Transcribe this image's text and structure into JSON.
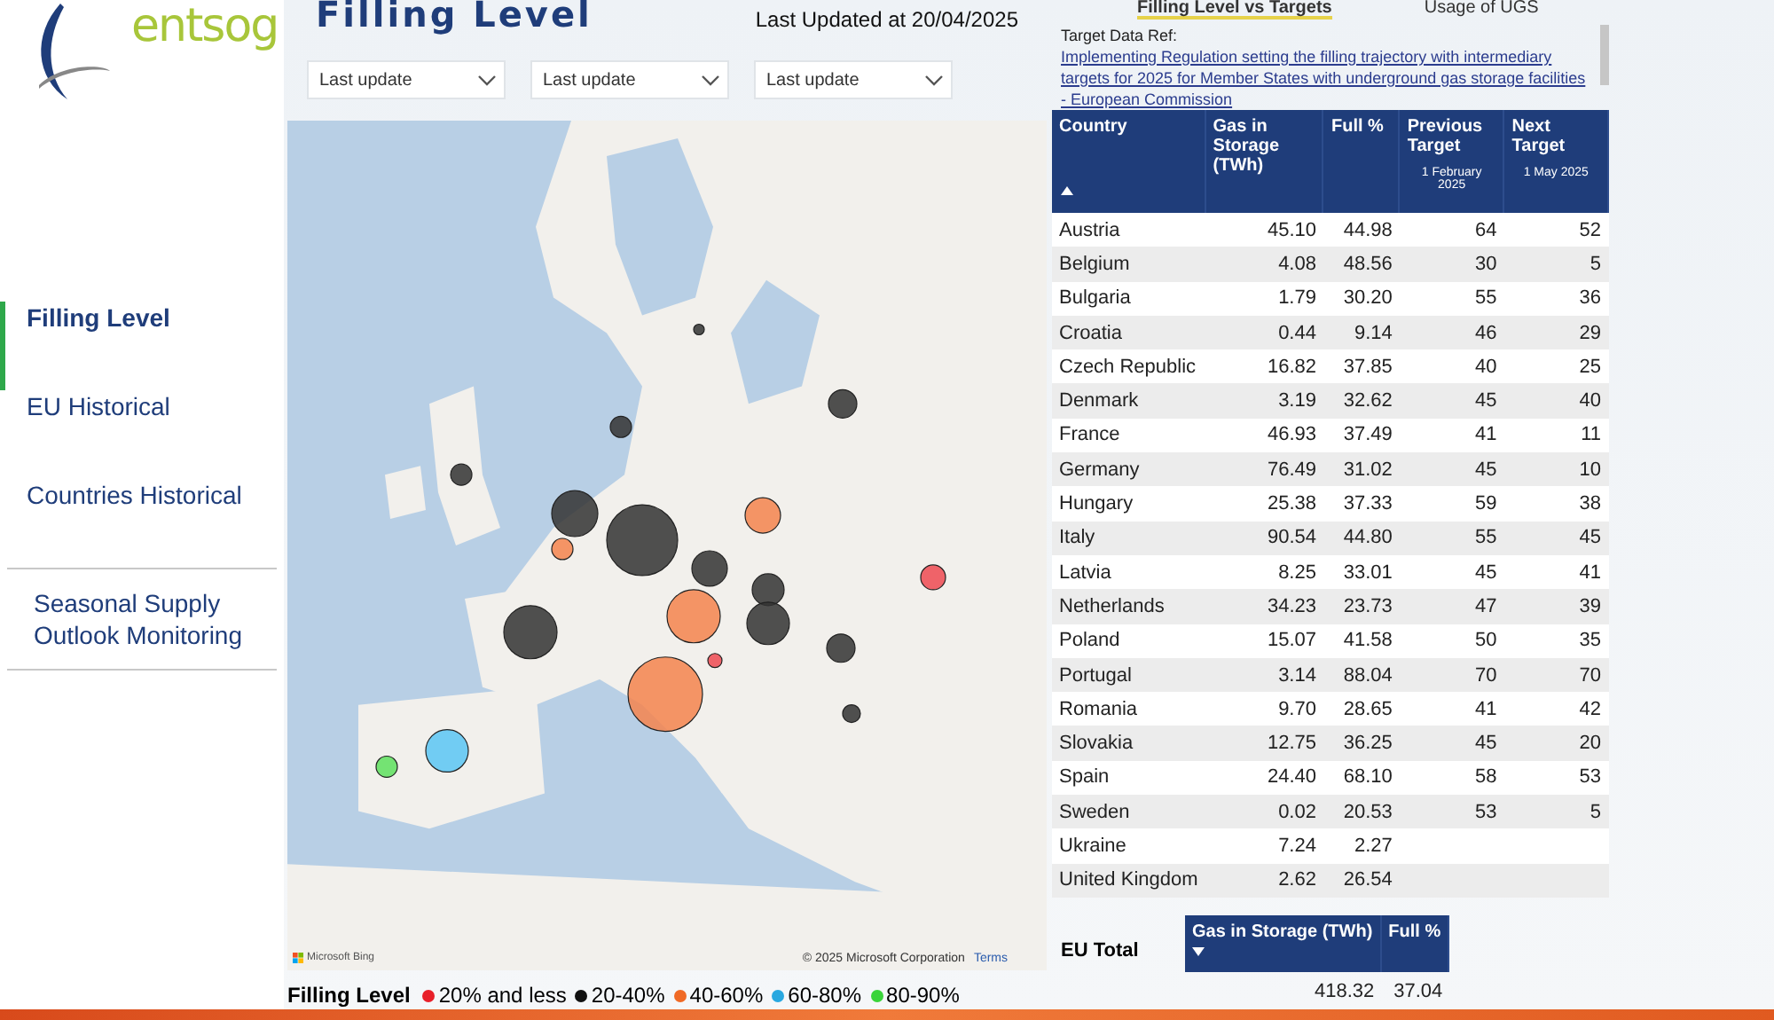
{
  "logo": {
    "text": "entsog"
  },
  "sidebar": {
    "items": [
      {
        "label": "Filling Level",
        "selected": true
      },
      {
        "label": "EU Historical",
        "selected": false
      },
      {
        "label": "Countries Historical",
        "selected": false
      },
      {
        "label": "Seasonal Supply Outlook Monitoring",
        "selected": false
      }
    ]
  },
  "header": {
    "title": "Filling Level",
    "last_updated": "Last Updated at 20/04/2025"
  },
  "filters": [
    {
      "value": "Last update"
    },
    {
      "value": "Last update"
    },
    {
      "value": "Last update"
    }
  ],
  "map": {
    "kind": "picture",
    "provider": "Microsoft Bing",
    "copyright": "© 2025 Microsoft Corporation",
    "terms_link": "Terms"
  },
  "tabs": [
    {
      "label": "Filling Level vs Targets",
      "selected": true
    },
    {
      "label": "Usage of UGS",
      "selected": false
    }
  ],
  "target_ref": {
    "label": "Target Data Ref:",
    "link": "Implementing Regulation setting the filling trajectory with intermediary targets for 2025 for Member States with underground gas storage facilities - European Commission"
  },
  "table": {
    "columns": [
      {
        "label": "Country"
      },
      {
        "label": "Gas in Storage (TWh)"
      },
      {
        "label": "Full %"
      },
      {
        "label": "Previous Target",
        "sub": "1 February 2025"
      },
      {
        "label": "Next Target",
        "sub": "1 May 2025"
      }
    ],
    "rows": [
      [
        "Austria",
        "45.10",
        "44.98",
        "64",
        "52"
      ],
      [
        "Belgium",
        "4.08",
        "48.56",
        "30",
        "5"
      ],
      [
        "Bulgaria",
        "1.79",
        "30.20",
        "55",
        "36"
      ],
      [
        "Croatia",
        "0.44",
        "9.14",
        "46",
        "29"
      ],
      [
        "Czech Republic",
        "16.82",
        "37.85",
        "40",
        "25"
      ],
      [
        "Denmark",
        "3.19",
        "32.62",
        "45",
        "40"
      ],
      [
        "France",
        "46.93",
        "37.49",
        "41",
        "11"
      ],
      [
        "Germany",
        "76.49",
        "31.02",
        "45",
        "10"
      ],
      [
        "Hungary",
        "25.38",
        "37.33",
        "59",
        "38"
      ],
      [
        "Italy",
        "90.54",
        "44.80",
        "55",
        "45"
      ],
      [
        "Latvia",
        "8.25",
        "33.01",
        "45",
        "41"
      ],
      [
        "Netherlands",
        "34.23",
        "23.73",
        "47",
        "39"
      ],
      [
        "Poland",
        "15.07",
        "41.58",
        "50",
        "35"
      ],
      [
        "Portugal",
        "3.14",
        "88.04",
        "70",
        "70"
      ],
      [
        "Romania",
        "9.70",
        "28.65",
        "41",
        "42"
      ],
      [
        "Slovakia",
        "12.75",
        "36.25",
        "45",
        "20"
      ],
      [
        "Spain",
        "24.40",
        "68.10",
        "58",
        "53"
      ],
      [
        "Sweden",
        "0.02",
        "20.53",
        "53",
        "5"
      ],
      [
        "Ukraine",
        "7.24",
        "2.27",
        "",
        ""
      ],
      [
        "United Kingdom",
        "2.62",
        "26.54",
        "",
        ""
      ]
    ]
  },
  "eu_total": {
    "label": "EU Total",
    "columns": [
      "Gas in Storage (TWh)",
      "Full %"
    ],
    "values": [
      "418.32",
      "37.04"
    ]
  },
  "legend": {
    "title": "Filling Level",
    "items": [
      {
        "label": "20% and less",
        "color": "#e8202a"
      },
      {
        "label": "20-40%",
        "color": "#111111"
      },
      {
        "label": "40-60%",
        "color": "#f06a25"
      },
      {
        "label": "60-80%",
        "color": "#29a8e0"
      },
      {
        "label": "80-90%",
        "color": "#3ad43a"
      }
    ]
  }
}
